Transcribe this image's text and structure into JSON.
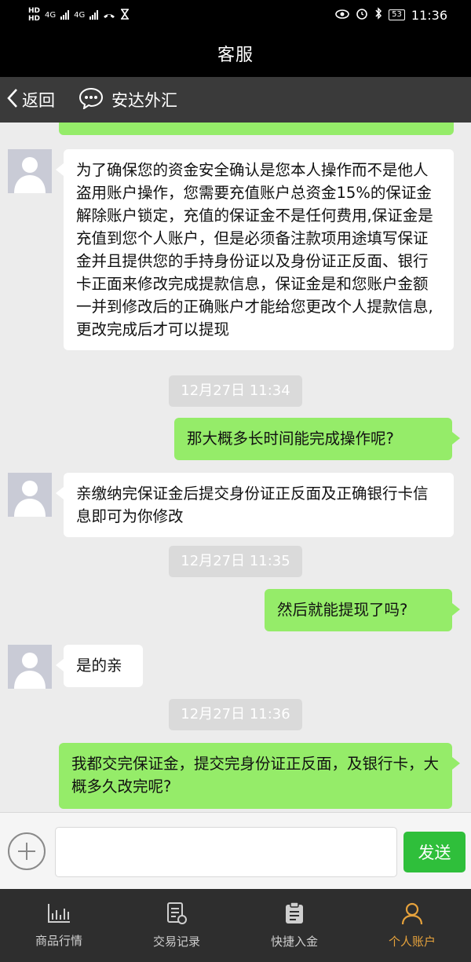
{
  "status_bar": {
    "left_badges": [
      "HD",
      "HD"
    ],
    "network": [
      "4G",
      "4G"
    ],
    "battery": "53",
    "time": "11:36",
    "icons": [
      "eye-icon",
      "alarm-icon",
      "bluetooth-icon",
      "battery-icon"
    ]
  },
  "title_bar": {
    "title": "客服"
  },
  "nav": {
    "back_label": "返回",
    "chat_name": "安达外汇",
    "chat_icon": "chat-bubble-icon"
  },
  "messages": [
    {
      "side": "in",
      "text": "为了确保您的资金安全确认是您本人操作而不是他人盗用账户操作，您需要充值账户总资金15%的保证金解除账户锁定，充值的保证金不是任何费用,保证金是充值到您个人账户，但是必须备注款项用途填写保证金并且提供您的手持身份证以及身份证正反面、银行卡正面来修改完成提款信息，保证金是和您账户金额一并到修改后的正确账户才能给您更改个人提款信息,更改完成后才可以提现"
    },
    {
      "type": "time",
      "text": "12月27日 11:34"
    },
    {
      "side": "out",
      "text": "那大概多长时间能完成操作呢?"
    },
    {
      "side": "in",
      "text": "亲缴纳完保证金后提交身份证正反面及正确银行卡信息即可为你修改"
    },
    {
      "type": "time",
      "text": "12月27日 11:35"
    },
    {
      "side": "out",
      "text": "然后就能提现了吗?"
    },
    {
      "side": "in",
      "text": "是的亲"
    },
    {
      "type": "time",
      "text": "12月27日 11:36"
    },
    {
      "side": "out",
      "text": "我都交完保证金，提交完身份证正反面，及银行卡，大概多久改完呢?"
    }
  ],
  "input": {
    "placeholder": "",
    "value": "",
    "send_label": "发送"
  },
  "tabs": [
    {
      "label": "商品行情",
      "icon": "chart-icon",
      "active": false
    },
    {
      "label": "交易记录",
      "icon": "record-icon",
      "active": false
    },
    {
      "label": "快捷入金",
      "icon": "clipboard-icon",
      "active": false
    },
    {
      "label": "个人账户",
      "icon": "user-icon",
      "active": true
    }
  ],
  "colors": {
    "bubble_out": "#95ec69",
    "bubble_in": "#ffffff",
    "send_button": "#2fbf3b",
    "active_tab": "#e6a23c"
  }
}
